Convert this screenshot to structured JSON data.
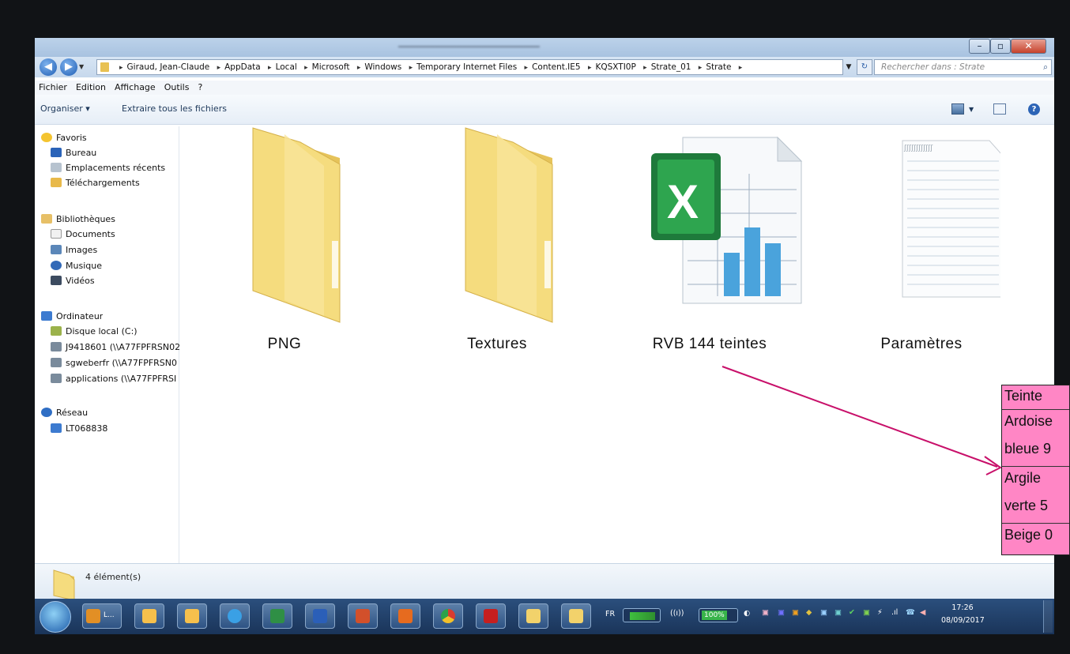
{
  "address": {
    "crumbs": [
      "Giraud, Jean-Claude",
      "AppData",
      "Local",
      "Microsoft",
      "Windows",
      "Temporary Internet Files",
      "Content.IE5",
      "KQSXTI0P",
      "Strate_01",
      "Strate"
    ],
    "separator": "▸",
    "search_placeholder": "Rechercher dans : Strate"
  },
  "menu": {
    "file": "Fichier",
    "edit": "Edition",
    "view": "Affichage",
    "tools": "Outils",
    "help": "?"
  },
  "toolbar": {
    "organize": "Organiser ▾",
    "extract": "Extraire tous les fichiers"
  },
  "sidebar": {
    "favorites": "Favoris",
    "desktop": "Bureau",
    "recent": "Emplacements récents",
    "downloads": "Téléchargements",
    "libraries": "Bibliothèques",
    "documents": "Documents",
    "images": "Images",
    "music": "Musique",
    "videos": "Vidéos",
    "computer": "Ordinateur",
    "local_disk": "Disque local (C:)",
    "net1": "J9418601 (\\\\A77FPFRSN02",
    "net2": "sgweberfr (\\\\A77FPFRSN0",
    "net3": "applications (\\\\A77FPFRSI",
    "network": "Réseau",
    "pc": "LT068838"
  },
  "files": {
    "f1": "PNG",
    "f2": "Textures",
    "f3": "RVB 144 teintes",
    "f4": "Paramètres"
  },
  "status": {
    "count": "4 élément(s)"
  },
  "taskbar": {
    "lang": "FR",
    "battery": "100%",
    "time": "17:26",
    "date": "08/09/2017",
    "outlook": "L..."
  },
  "annotation": {
    "r1": "Teinte",
    "r2": "Ardoise",
    "r3": "bleue 9",
    "r4": "Argile",
    "r5": "verte 5",
    "r6": "Beige 0"
  },
  "colors": {
    "annotation_bg": "#ff86c5",
    "arrow": "#c8106a",
    "folder": "#f2d26b"
  }
}
